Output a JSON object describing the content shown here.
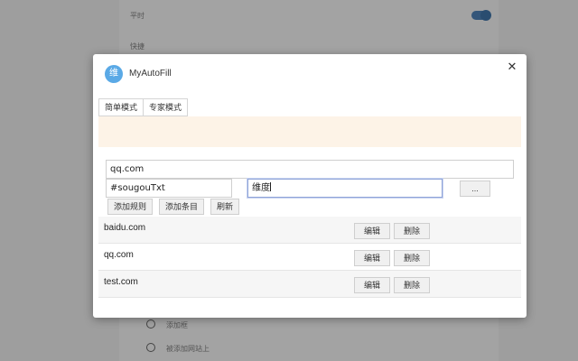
{
  "background": {
    "top_label": "平时",
    "second_label": "快捷",
    "list_item_1": "添加框",
    "list_item_2": "被添加网站上"
  },
  "dialog": {
    "logo_glyph": "维",
    "title": "MyAutoFill",
    "close_glyph": "✕",
    "tabs": [
      {
        "label": "简单模式"
      },
      {
        "label": "专家模式"
      }
    ],
    "domain_input_value": "qq.com",
    "selector_input_value": "#sougouTxt",
    "value_input_value": "维度",
    "more_button_label": "...",
    "add_rule_label": "添加规则",
    "add_item_label": "添加条目",
    "refresh_label": "刷新",
    "rows": [
      {
        "domain": "baidu.com",
        "edit": "编辑",
        "delete": "删除"
      },
      {
        "domain": "qq.com",
        "edit": "编辑",
        "delete": "删除"
      },
      {
        "domain": "test.com",
        "edit": "编辑",
        "delete": "删除"
      }
    ]
  },
  "colors": {
    "logo_bg": "#5aa9e6",
    "notice_bg": "#fdf3e7",
    "overlay_bg": "#9e9e9e"
  }
}
